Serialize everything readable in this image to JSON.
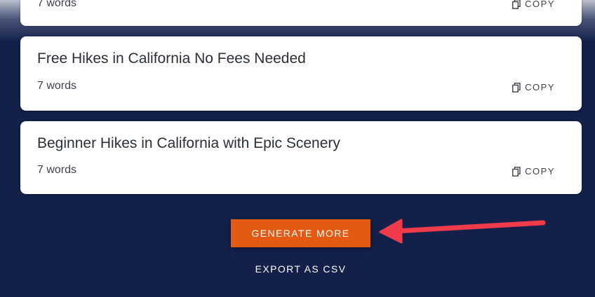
{
  "colors": {
    "background": "#12204a",
    "card": "#ffffff",
    "accent_button": "#e55a12",
    "annotation_arrow": "#ef3b4a"
  },
  "results": [
    {
      "title": "",
      "words": "7 words",
      "copy_label": "COPY",
      "copy_icon": "copy-icon"
    },
    {
      "title": "Free Hikes in California No Fees Needed",
      "words": "7 words",
      "copy_label": "COPY",
      "copy_icon": "copy-icon"
    },
    {
      "title": "Beginner Hikes in California with Epic Scenery",
      "words": "7 words",
      "copy_label": "COPY",
      "copy_icon": "copy-icon"
    }
  ],
  "actions": {
    "generate_more_label": "GENERATE MORE",
    "export_label": "EXPORT AS CSV"
  },
  "annotation": {
    "arrow_icon": "arrow-left-icon"
  }
}
